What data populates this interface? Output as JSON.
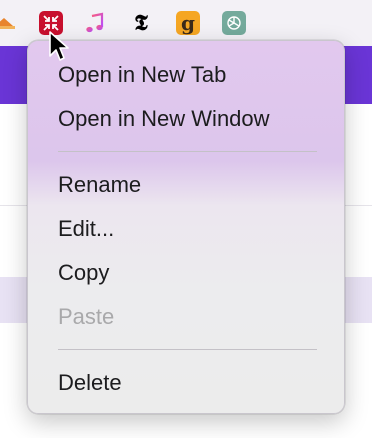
{
  "bookmarks": [
    {
      "icon": "home-icon",
      "color": "#e8842c"
    },
    {
      "icon": "collapse-arrows-icon",
      "color": "#c8102e"
    },
    {
      "icon": "music-note-icon",
      "color": "#fa2d55"
    },
    {
      "icon": "nyt-logo-icon",
      "color": "#000000"
    },
    {
      "icon": "goodreads-g-icon",
      "color": "#f5a623"
    },
    {
      "icon": "chatgpt-icon",
      "color": "#74aa9c"
    }
  ],
  "menu": {
    "items": [
      {
        "label": "Open in New Tab",
        "enabled": true
      },
      {
        "label": "Open in New Window",
        "enabled": true
      },
      {
        "label": "Rename",
        "enabled": true
      },
      {
        "label": "Edit...",
        "enabled": true
      },
      {
        "label": "Copy",
        "enabled": true
      },
      {
        "label": "Paste",
        "enabled": false
      },
      {
        "label": "Delete",
        "enabled": true
      }
    ]
  },
  "colors": {
    "accent_purple": "#6a35d6",
    "disabled_text": "#a9a9ab"
  }
}
